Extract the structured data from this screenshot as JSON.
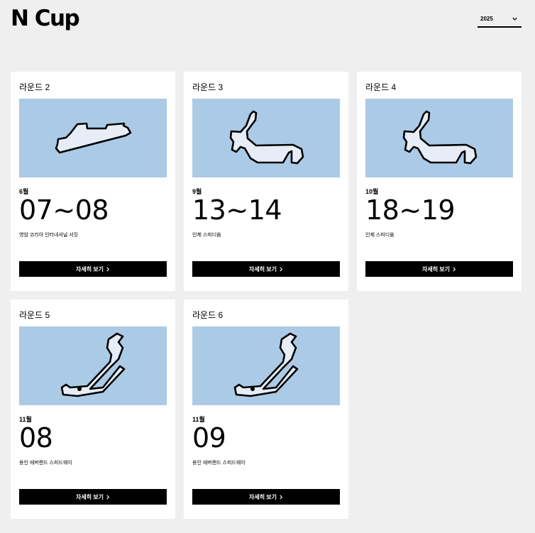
{
  "header": {
    "title": "N Cup",
    "year_select": {
      "value": "2025",
      "icon": "chevron-down-icon"
    }
  },
  "rounds": [
    {
      "label": "라운드 2",
      "month": "6월",
      "dates": "07~08",
      "venue": "영암 코리아 인터내셔널 서킷",
      "button_label": "자세히 보기",
      "track": "korea-international-circuit"
    },
    {
      "label": "라운드 3",
      "month": "9월",
      "dates": "13~14",
      "venue": "인제 스피디움",
      "button_label": "자세히 보기",
      "track": "inje-speedium"
    },
    {
      "label": "라운드 4",
      "month": "10월",
      "dates": "18~19",
      "venue": "인제 스피디움",
      "button_label": "자세히 보기",
      "track": "inje-speedium"
    },
    {
      "label": "라운드 5",
      "month": "11월",
      "dates": "08",
      "venue": "용인 에버랜드 스피드웨이",
      "button_label": "자세히 보기",
      "track": "everland-speedway"
    },
    {
      "label": "라운드 6",
      "month": "11월",
      "dates": "09",
      "venue": "용인 에버랜드 스피드웨이",
      "button_label": "자세히 보기",
      "track": "everland-speedway"
    }
  ],
  "colors": {
    "page_background": "#efefef",
    "card_background": "#ffffff",
    "map_background": "#abcae6",
    "track_fill": "#e6edf7",
    "button_background": "#000000"
  }
}
